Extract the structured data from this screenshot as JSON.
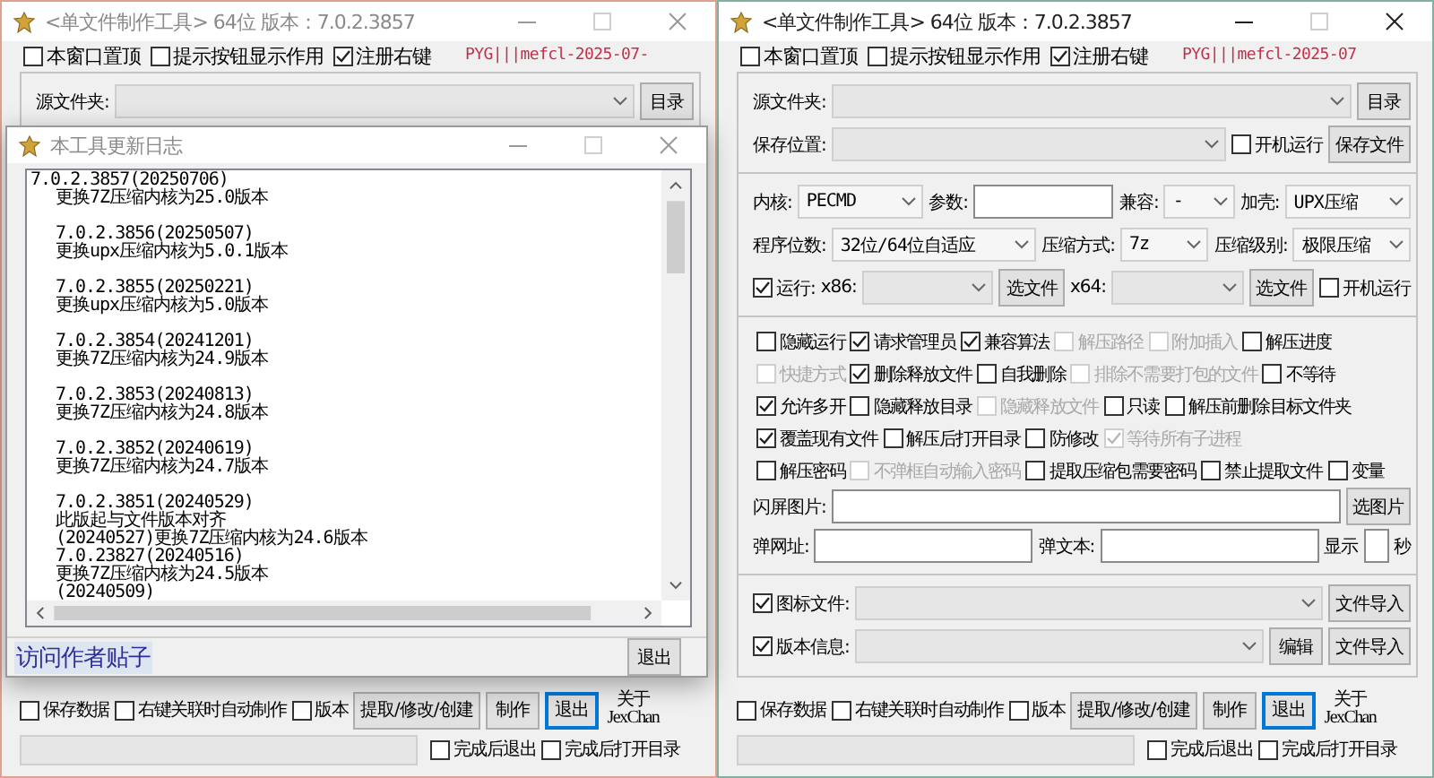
{
  "windows": [
    {
      "title": "<单文件制作工具> 64位 版本：7.0.2.3857",
      "active": false,
      "top_options": [
        {
          "text": "本窗口置顶",
          "checked": false
        },
        {
          "text": "提示按钮显示作用",
          "checked": false
        },
        {
          "text": "注册右键",
          "checked": true
        }
      ],
      "signature": "PYG|||mefcl-2025-07-",
      "panel": {
        "sections": [
          {
            "rows": [
              {
                "items": [
                  {
                    "kind": "label",
                    "text": "源文件夹:"
                  },
                  {
                    "kind": "combo"
                  },
                  {
                    "kind": "button",
                    "text": "目录"
                  }
                ]
              }
            ]
          }
        ]
      },
      "changelog_dialog": {
        "title": "本工具更新日志",
        "entries": [
          {
            "version": "7.0.2.3857(20250706)",
            "notes": [
              "更换7Z压缩内核为25.0版本"
            ]
          },
          {
            "version": "7.0.2.3856(20250507)",
            "notes": [
              "更换upx压缩内核为5.0.1版本"
            ]
          },
          {
            "version": "7.0.2.3855(20250221)",
            "notes": [
              "更换upx压缩内核为5.0版本"
            ]
          },
          {
            "version": "7.0.2.3854(20241201)",
            "notes": [
              "更换7Z压缩内核为24.9版本"
            ]
          },
          {
            "version": "7.0.2.3853(20240813)",
            "notes": [
              "更换7Z压缩内核为24.8版本"
            ]
          },
          {
            "version": "7.0.2.3852(20240619)",
            "notes": [
              "更换7Z压缩内核为24.7版本"
            ]
          },
          {
            "version": "7.0.2.3851(20240529)",
            "notes": [
              "此版起与文件版本对齐",
              "(20240527)更换7Z压缩内核为24.6版本",
              "7.0.23827(20240516)",
              "更换7Z压缩内核为24.5版本",
              "(20240509)"
            ]
          }
        ],
        "link": "访问作者贴子",
        "button": "退出"
      },
      "bottom": {
        "options": [
          {
            "text": "保存数据",
            "checked": false
          },
          {
            "text": "右键关联时自动制作",
            "checked": false
          },
          {
            "text": "版本",
            "checked": false
          }
        ],
        "buttons": [
          {
            "text": "提取/修改/创建",
            "default": false
          },
          {
            "text": "制作",
            "default": false
          },
          {
            "text": "退出",
            "default": true
          }
        ],
        "about_lines": [
          "关于",
          "JexChan"
        ],
        "progress": {
          "level": 0
        },
        "finish_options": [
          {
            "text": "完成后退出",
            "checked": false
          },
          {
            "text": "完成后打开目录",
            "checked": false
          }
        ]
      }
    },
    {
      "title": "<单文件制作工具> 64位 版本：7.0.2.3857",
      "active": true,
      "top_options": [
        {
          "text": "本窗口置顶",
          "checked": false
        },
        {
          "text": "提示按钮显示作用",
          "checked": false
        },
        {
          "text": "注册右键",
          "checked": true
        }
      ],
      "signature": "PYG|||mefcl-2025-07",
      "panel": {
        "sections": [
          {
            "rows": [
              {
                "items": [
                  {
                    "kind": "label",
                    "text": "源文件夹:"
                  },
                  {
                    "kind": "combo"
                  },
                  {
                    "kind": "button",
                    "text": "目录"
                  }
                ]
              },
              {
                "items": [
                  {
                    "kind": "label",
                    "text": "保存位置:"
                  },
                  {
                    "kind": "combo"
                  },
                  {
                    "kind": "check",
                    "text": "开机运行",
                    "checked": false,
                    "disabled": false
                  },
                  {
                    "kind": "button",
                    "text": "保存文件"
                  }
                ]
              }
            ]
          },
          {
            "rows": [
              {
                "items": [
                  {
                    "kind": "label",
                    "text": "内核:"
                  },
                  {
                    "kind": "combo",
                    "value": "PECMD"
                  },
                  {
                    "kind": "label",
                    "text": "参数:"
                  },
                  {
                    "kind": "input"
                  },
                  {
                    "kind": "label",
                    "text": "兼容:"
                  },
                  {
                    "kind": "combo",
                    "value": "-"
                  },
                  {
                    "kind": "label",
                    "text": "加壳:"
                  },
                  {
                    "kind": "combo",
                    "value": "UPX压缩"
                  }
                ]
              },
              {
                "items": [
                  {
                    "kind": "label",
                    "text": "程序位数:"
                  },
                  {
                    "kind": "combo",
                    "value": "32位/64位自适应"
                  },
                  {
                    "kind": "label",
                    "text": "压缩方式:"
                  },
                  {
                    "kind": "combo",
                    "value": "7z"
                  },
                  {
                    "kind": "label",
                    "text": "压缩级别:"
                  },
                  {
                    "kind": "combo",
                    "value": "极限压缩"
                  }
                ]
              },
              {
                "items": [
                  {
                    "kind": "check",
                    "text": "运行:",
                    "checked": true,
                    "disabled": false
                  },
                  {
                    "kind": "label",
                    "text": "x86:"
                  },
                  {
                    "kind": "combo"
                  },
                  {
                    "kind": "button",
                    "text": "选文件"
                  },
                  {
                    "kind": "label",
                    "text": "x64:"
                  },
                  {
                    "kind": "combo"
                  },
                  {
                    "kind": "button",
                    "text": "选文件"
                  },
                  {
                    "kind": "check",
                    "text": "开机运行",
                    "checked": false,
                    "disabled": false
                  }
                ]
              }
            ]
          },
          {
            "rows": [
              {
                "items": [
                  {
                    "kind": "check",
                    "text": "隐藏运行",
                    "checked": false,
                    "disabled": false
                  },
                  {
                    "kind": "check",
                    "text": "请求管理员",
                    "checked": true,
                    "disabled": false
                  },
                  {
                    "kind": "check",
                    "text": "兼容算法",
                    "checked": true,
                    "disabled": false
                  },
                  {
                    "kind": "check",
                    "text": "解压路径",
                    "checked": false,
                    "disabled": true
                  },
                  {
                    "kind": "check",
                    "text": "附加插入",
                    "checked": false,
                    "disabled": true
                  },
                  {
                    "kind": "check",
                    "text": "解压进度",
                    "checked": false,
                    "disabled": false
                  }
                ]
              },
              {
                "items": [
                  {
                    "kind": "check",
                    "text": "快捷方式",
                    "checked": false,
                    "disabled": true
                  },
                  {
                    "kind": "check",
                    "text": "删除释放文件",
                    "checked": true,
                    "disabled": false
                  },
                  {
                    "kind": "check",
                    "text": "自我删除",
                    "checked": false,
                    "disabled": false
                  },
                  {
                    "kind": "check",
                    "text": "排除不需要打包的文件",
                    "checked": false,
                    "disabled": true
                  },
                  {
                    "kind": "check",
                    "text": "不等待",
                    "checked": false,
                    "disabled": false
                  }
                ]
              },
              {
                "items": [
                  {
                    "kind": "check",
                    "text": "允许多开",
                    "checked": true,
                    "disabled": false
                  },
                  {
                    "kind": "check",
                    "text": "隐藏释放目录",
                    "checked": false,
                    "disabled": false
                  },
                  {
                    "kind": "check",
                    "text": "隐藏释放文件",
                    "checked": false,
                    "disabled": true
                  },
                  {
                    "kind": "check",
                    "text": "只读",
                    "checked": false,
                    "disabled": false
                  },
                  {
                    "kind": "check",
                    "text": "解压前删除目标文件夹",
                    "checked": false,
                    "disabled": false
                  }
                ]
              },
              {
                "items": [
                  {
                    "kind": "check",
                    "text": "覆盖现有文件",
                    "checked": true,
                    "disabled": false
                  },
                  {
                    "kind": "check",
                    "text": "解压后打开目录",
                    "checked": false,
                    "disabled": false
                  },
                  {
                    "kind": "check",
                    "text": "防修改",
                    "checked": false,
                    "disabled": false
                  },
                  {
                    "kind": "check",
                    "text": "等待所有子进程",
                    "checked": true,
                    "disabled": true
                  }
                ]
              },
              {
                "items": [
                  {
                    "kind": "check",
                    "text": "解压密码",
                    "checked": false,
                    "disabled": false
                  },
                  {
                    "kind": "check",
                    "text": "不弹框自动输入密码",
                    "checked": false,
                    "disabled": true
                  },
                  {
                    "kind": "check",
                    "text": "提取压缩包需要密码",
                    "checked": false,
                    "disabled": false
                  },
                  {
                    "kind": "check",
                    "text": "禁止提取文件",
                    "checked": false,
                    "disabled": false
                  },
                  {
                    "kind": "check",
                    "text": "变量",
                    "checked": false,
                    "disabled": false
                  }
                ]
              },
              {
                "items": [
                  {
                    "kind": "label",
                    "text": "闪屏图片:"
                  },
                  {
                    "kind": "input"
                  },
                  {
                    "kind": "button",
                    "text": "选图片"
                  }
                ]
              },
              {
                "items": [
                  {
                    "kind": "label",
                    "text": "弹网址:"
                  },
                  {
                    "kind": "input"
                  },
                  {
                    "kind": "label",
                    "text": "弹文本:"
                  },
                  {
                    "kind": "input"
                  },
                  {
                    "kind": "label",
                    "text": "显示"
                  },
                  {
                    "kind": "small_input"
                  },
                  {
                    "kind": "label",
                    "text": "秒"
                  }
                ]
              }
            ]
          },
          {
            "rows": [
              {
                "items": [
                  {
                    "kind": "check",
                    "text": "图标文件:",
                    "checked": true,
                    "disabled": false
                  },
                  {
                    "kind": "combo"
                  },
                  {
                    "kind": "button",
                    "text": "文件导入"
                  }
                ]
              },
              {
                "items": [
                  {
                    "kind": "check",
                    "text": "版本信息:",
                    "checked": true,
                    "disabled": false
                  },
                  {
                    "kind": "combo"
                  },
                  {
                    "kind": "button",
                    "text": "编辑"
                  },
                  {
                    "kind": "button",
                    "text": "文件导入"
                  }
                ]
              }
            ]
          }
        ]
      },
      "bottom": {
        "options": [
          {
            "text": "保存数据",
            "checked": false
          },
          {
            "text": "右键关联时自动制作",
            "checked": false
          },
          {
            "text": "版本",
            "checked": false
          }
        ],
        "buttons": [
          {
            "text": "提取/修改/创建",
            "default": false
          },
          {
            "text": "制作",
            "default": false
          },
          {
            "text": "退出",
            "default": true
          }
        ],
        "about_lines": [
          "关于",
          "JexChan"
        ],
        "progress": {
          "level": 0
        },
        "finish_options": [
          {
            "text": "完成后退出",
            "checked": false
          },
          {
            "text": "完成后打开目录",
            "checked": false
          }
        ]
      }
    }
  ]
}
